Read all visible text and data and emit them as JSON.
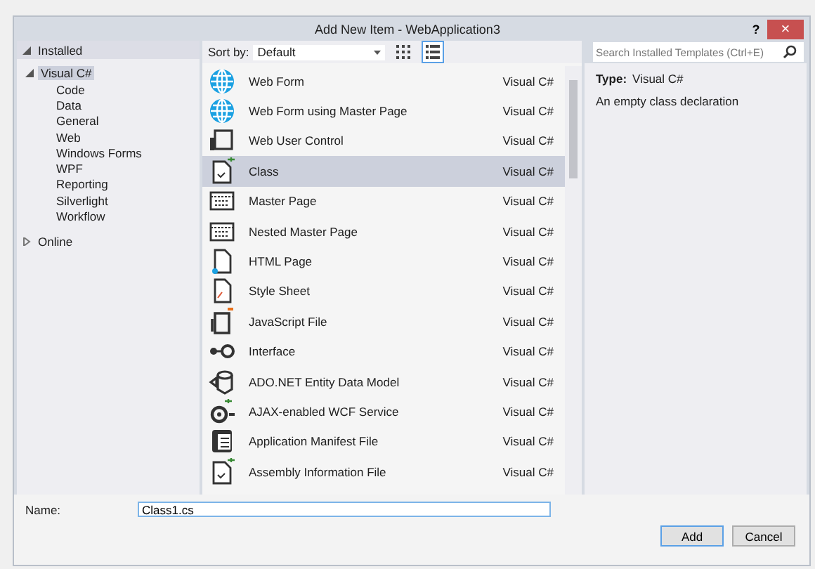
{
  "window": {
    "title": "Add New Item - WebApplication3",
    "help": "?",
    "close": "×"
  },
  "sidebar": {
    "items": [
      {
        "label": "Installed",
        "expanded": true,
        "selected": false,
        "children": [
          {
            "label": "Visual C#",
            "expanded": true,
            "selected": true,
            "children": [
              {
                "label": "Code",
                "selected": false
              },
              {
                "label": "Data",
                "selected": false
              },
              {
                "label": "General",
                "selected": false
              },
              {
                "label": "Web",
                "selected": false
              },
              {
                "label": "Windows Forms",
                "selected": false
              },
              {
                "label": "WPF",
                "selected": false
              },
              {
                "label": "Reporting",
                "selected": false
              },
              {
                "label": "Silverlight",
                "selected": false
              },
              {
                "label": "Workflow",
                "selected": false
              }
            ]
          }
        ]
      },
      {
        "label": "Online",
        "expanded": false,
        "selected": false
      }
    ]
  },
  "toolbar": {
    "sort_label": "Sort by:",
    "sort_value": "Default",
    "views": [
      {
        "kind": "grid",
        "selected": false
      },
      {
        "kind": "list",
        "selected": true
      }
    ]
  },
  "search": {
    "placeholder": "Search Installed Templates (Ctrl+E)"
  },
  "templates": [
    {
      "kind": "globe",
      "name": "Web Form",
      "language": "Visual C#",
      "selected": false
    },
    {
      "kind": "globe",
      "name": "Web Form using Master Page",
      "language": "Visual C#",
      "selected": false
    },
    {
      "kind": "control",
      "name": "Web User Control",
      "language": "Visual C#",
      "selected": false
    },
    {
      "kind": "class",
      "name": "Class",
      "language": "Visual C#",
      "selected": true
    },
    {
      "kind": "master",
      "name": "Master Page",
      "language": "Visual C#",
      "selected": false
    },
    {
      "kind": "master",
      "name": "Nested Master Page",
      "language": "Visual C#",
      "selected": false
    },
    {
      "kind": "html",
      "name": "HTML Page",
      "language": "Visual C#",
      "selected": false
    },
    {
      "kind": "css",
      "name": "Style Sheet",
      "language": "Visual C#",
      "selected": false
    },
    {
      "kind": "js",
      "name": "JavaScript File",
      "language": "Visual C#",
      "selected": false
    },
    {
      "kind": "interface",
      "name": "Interface",
      "language": "Visual C#",
      "selected": false
    },
    {
      "kind": "ado",
      "name": "ADO.NET Entity Data Model",
      "language": "Visual C#",
      "selected": false
    },
    {
      "kind": "wcf",
      "name": "AJAX-enabled WCF Service",
      "language": "Visual C#",
      "selected": false
    },
    {
      "kind": "manifest",
      "name": "Application Manifest File",
      "language": "Visual C#",
      "selected": false
    },
    {
      "kind": "class",
      "name": "Assembly Information File",
      "language": "Visual C#",
      "selected": false
    }
  ],
  "details": {
    "type_label": "Type:",
    "type_value": "Visual C#",
    "description": "An empty class declaration"
  },
  "name_field": {
    "label": "Name:",
    "value": "Class1.cs"
  },
  "buttons": [
    {
      "label": "Add",
      "default": true
    },
    {
      "label": "Cancel",
      "default": false
    }
  ]
}
